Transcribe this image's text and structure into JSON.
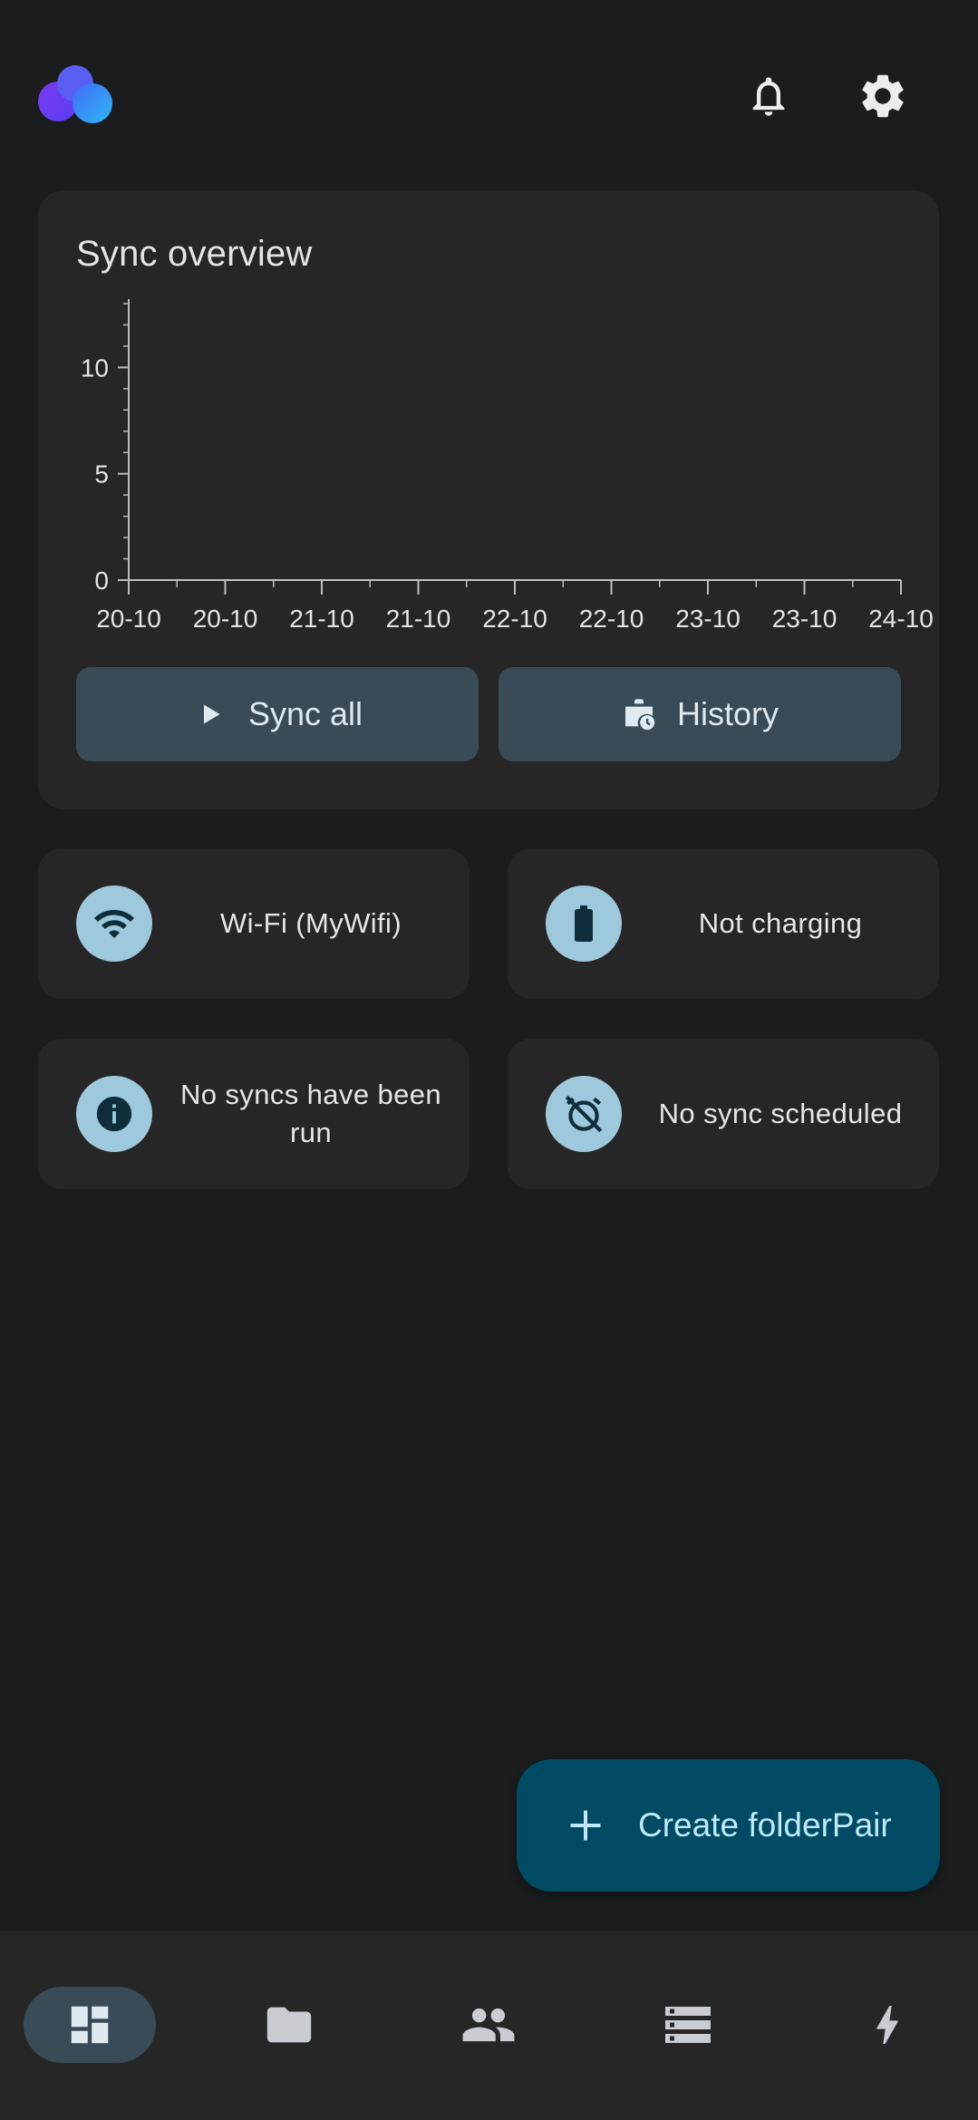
{
  "header": {
    "logo_icon": "app-logo-icon",
    "notifications_icon": "bell-icon",
    "settings_icon": "gear-icon"
  },
  "overview": {
    "title": "Sync overview",
    "sync_all_label": "Sync all",
    "history_label": "History"
  },
  "chart_data": {
    "type": "bar",
    "categories": [
      "20-10",
      "20-10",
      "21-10",
      "21-10",
      "22-10",
      "22-10",
      "23-10",
      "23-10",
      "24-10"
    ],
    "values": [
      0,
      0,
      0,
      0,
      0,
      0,
      0,
      0,
      0
    ],
    "yticks": [
      "0",
      "5",
      "10"
    ],
    "ylim": [
      0,
      13
    ],
    "grid": false
  },
  "status": {
    "network_label": "Wi-Fi (MyWifi)",
    "charging_label": "Not charging",
    "last_sync_label": "No syncs have been run",
    "schedule_label": "No sync scheduled"
  },
  "fab": {
    "label": "Create folderPair"
  },
  "nav": {
    "items": [
      "dashboard-icon",
      "folder-icon",
      "people-icon",
      "storage-icon",
      "bolt-icon"
    ]
  },
  "colors": {
    "background": "#1a1c1e",
    "card": "#262627",
    "button": "#384b56",
    "icon_circle": "#9ec9dc",
    "fab": "#004a63",
    "fab_text": "#bfe8f8"
  }
}
